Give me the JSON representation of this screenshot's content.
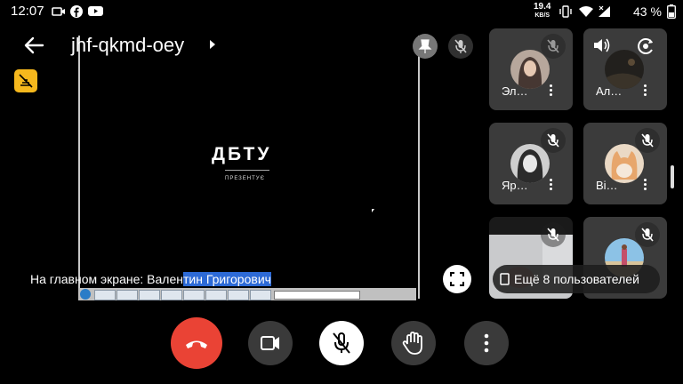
{
  "status_bar": {
    "time": "12:07",
    "net_speed_value": "19.4",
    "net_speed_unit": "KB/S",
    "battery": "43 %",
    "left_icons": [
      "video-camera-icon",
      "facebook-icon",
      "youtube-icon"
    ],
    "right_icons": [
      "vibrate-icon",
      "wifi-icon",
      "signal-icon",
      "battery-icon"
    ]
  },
  "meeting": {
    "code": "jhf-qkmd-oey",
    "presenter_prefix": "На главном экране: Вален",
    "presenter_highlight": "тин Григорович",
    "slide_logo": "ДБТУ",
    "slide_sub": "ПРЕЗЕНТУЄ"
  },
  "tiles": [
    {
      "name": "Эл…",
      "avatar": "avatar-woman-dark-hair",
      "muted": true
    },
    {
      "name": "Ал…",
      "avatar": "avatar-dark",
      "muted": false,
      "speaker": true
    },
    {
      "name": "Яр…",
      "avatar": "avatar-woman-bw",
      "muted": true
    },
    {
      "name": "Ві…",
      "avatar": "avatar-cat",
      "muted": true
    },
    {
      "name": "",
      "avatar": "video-hand",
      "muted": true
    },
    {
      "name": "",
      "avatar": "avatar-beach",
      "muted": true
    }
  ],
  "more_users": "Ещё 8 пользователей",
  "controls": [
    "end-call",
    "camera",
    "microphone-off",
    "raise-hand",
    "more-options"
  ],
  "colors": {
    "end_call": "#ea4335",
    "badge": "#f6b81d",
    "highlight": "#2d6ad6"
  }
}
